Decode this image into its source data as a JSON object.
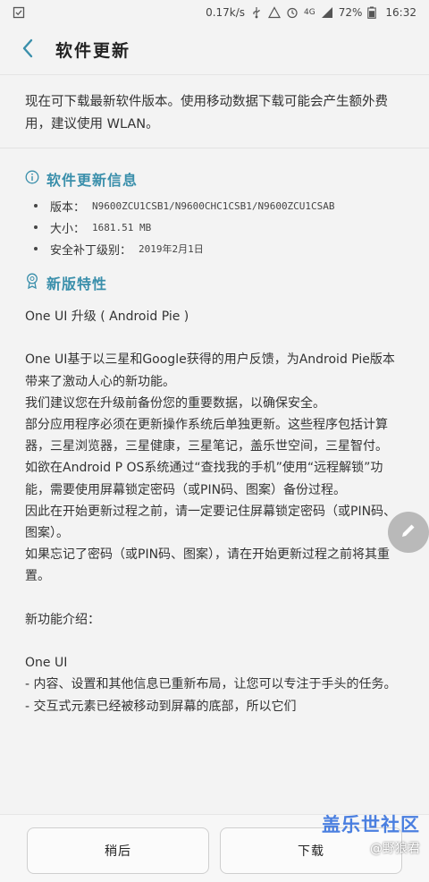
{
  "status_bar": {
    "net_speed": "0.17k/s",
    "network": "4G",
    "battery": "72%",
    "time": "16:32"
  },
  "app_bar": {
    "title": "软件更新"
  },
  "intro": "现在可下载最新软件版本。使用移动数据下载可能会产生额外费用，建议使用 WLAN。",
  "info_section": {
    "title": "软件更新信息",
    "items": [
      {
        "key": "版本：",
        "value": "N9600ZCU1CSB1/N9600CHC1CSB1/N9600ZCU1CSAB"
      },
      {
        "key": "大小：",
        "value": "1681.51 MB"
      },
      {
        "key": "安全补丁级别：",
        "value": "2019年2月1日"
      }
    ]
  },
  "features_section": {
    "title": "新版特性"
  },
  "notes": [
    "One UI 升级 ( Android Pie )",
    "",
    "One UI基于以三星和Google获得的用户反馈，为Android Pie版本带来了激动人心的新功能。",
    "我们建议您在升级前备份您的重要数据，以确保安全。",
    "部分应用程序必须在更新操作系统后单独更新。这些程序包括计算器，三星浏览器，三星健康，三星笔记，盖乐世空间，三星智付。",
    "如欲在Android P OS系统通过“查找我的手机”使用“远程解锁”功能，需要使用屏幕锁定密码（或PIN码、图案）备份过程。",
    "因此在开始更新过程之前，请一定要记住屏幕锁定密码（或PIN码、图案）。",
    "如果忘记了密码（或PIN码、图案），请在开始更新过程之前将其重置。",
    "",
    "新功能介绍：",
    "",
    "One UI",
    "- 内容、设置和其他信息已重新布局，让您可以专注于手头的任务。",
    "- 交互式元素已经被移动到屏幕的底部，所以它们"
  ],
  "buttons": {
    "later": "稍后",
    "download": "下载"
  },
  "watermark": {
    "title": "盖乐世社区",
    "sub": "@野狼君"
  },
  "colors": {
    "accent": "#3a8fab",
    "background": "#f3f3f3"
  }
}
